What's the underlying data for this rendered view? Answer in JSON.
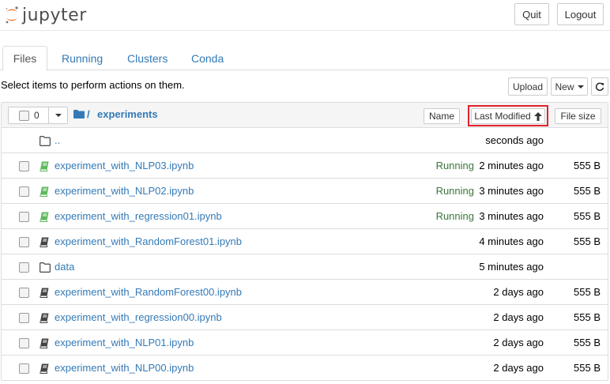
{
  "header": {
    "logo_text": "jupyter",
    "quit_label": "Quit",
    "logout_label": "Logout"
  },
  "tabs": [
    {
      "label": "Files",
      "active": true
    },
    {
      "label": "Running",
      "active": false
    },
    {
      "label": "Clusters",
      "active": false
    },
    {
      "label": "Conda",
      "active": false
    }
  ],
  "toolbar": {
    "select_text": "Select items to perform actions on them.",
    "upload_label": "Upload",
    "new_label": "New",
    "refresh_icon": "refresh-icon"
  },
  "list_header": {
    "selected_count": "0",
    "breadcrumb_sep": "/",
    "current_folder": "experiments",
    "sort_name_label": "Name",
    "sort_modified_label": "Last Modified",
    "sort_modified_arrow": "🡑",
    "sort_size_label": "File size"
  },
  "colors": {
    "link": "#337ab7",
    "running": "#3c763d",
    "highlight": "#e0222d",
    "notebook_running": "#5cb85c",
    "notebook_idle": "#444444"
  },
  "rows": [
    {
      "type": "parent",
      "icon": "folder-icon",
      "name": "..",
      "status": "",
      "modified": "seconds ago",
      "size": ""
    },
    {
      "type": "notebook",
      "icon": "notebook-running-icon",
      "name": "experiment_with_NLP03.ipynb",
      "status": "Running",
      "modified": "2 minutes ago",
      "size": "555 B"
    },
    {
      "type": "notebook",
      "icon": "notebook-running-icon",
      "name": "experiment_with_NLP02.ipynb",
      "status": "Running",
      "modified": "3 minutes ago",
      "size": "555 B"
    },
    {
      "type": "notebook",
      "icon": "notebook-running-icon",
      "name": "experiment_with_regression01.ipynb",
      "status": "Running",
      "modified": "3 minutes ago",
      "size": "555 B"
    },
    {
      "type": "notebook",
      "icon": "notebook-icon",
      "name": "experiment_with_RandomForest01.ipynb",
      "status": "",
      "modified": "4 minutes ago",
      "size": "555 B"
    },
    {
      "type": "folder",
      "icon": "folder-icon",
      "name": "data",
      "status": "",
      "modified": "5 minutes ago",
      "size": ""
    },
    {
      "type": "notebook",
      "icon": "notebook-icon",
      "name": "experiment_with_RandomForest00.ipynb",
      "status": "",
      "modified": "2 days ago",
      "size": "555 B"
    },
    {
      "type": "notebook",
      "icon": "notebook-icon",
      "name": "experiment_with_regression00.ipynb",
      "status": "",
      "modified": "2 days ago",
      "size": "555 B"
    },
    {
      "type": "notebook",
      "icon": "notebook-icon",
      "name": "experiment_with_NLP01.ipynb",
      "status": "",
      "modified": "2 days ago",
      "size": "555 B"
    },
    {
      "type": "notebook",
      "icon": "notebook-icon",
      "name": "experiment_with_NLP00.ipynb",
      "status": "",
      "modified": "2 days ago",
      "size": "555 B"
    }
  ]
}
